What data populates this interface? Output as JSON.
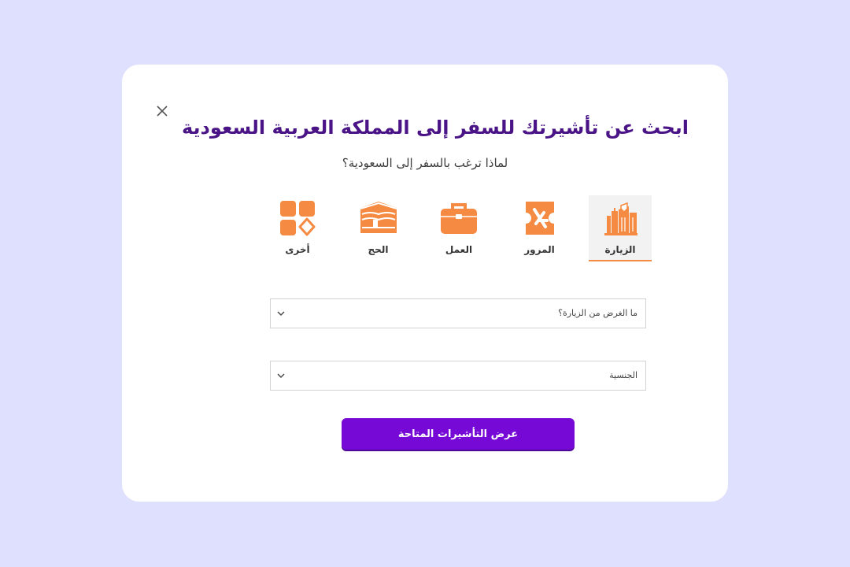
{
  "colors": {
    "page_bg": "#dfe0fd",
    "title": "#4a1486",
    "icon_accent": "#f58a42",
    "button": "#7609d6"
  },
  "modal": {
    "title": "ابحث عن تأشيرتك للسفر إلى المملكة العربية السعودية",
    "subtitle": "لماذا ترغب بالسفر إلى السعودية؟",
    "close_icon": "close-icon"
  },
  "categories": [
    {
      "label": "الزيارة",
      "icon": "buildings-icon",
      "selected": true
    },
    {
      "label": "المرور",
      "icon": "plane-ticket-icon",
      "selected": false
    },
    {
      "label": "العمل",
      "icon": "briefcase-icon",
      "selected": false
    },
    {
      "label": "الحج",
      "icon": "kaaba-icon",
      "selected": false
    },
    {
      "label": "أخرى",
      "icon": "grid-icon",
      "selected": false
    }
  ],
  "form": {
    "purpose_placeholder": "ما الغرض من الزيارة؟",
    "nationality_placeholder": "الجنسية",
    "submit_label": "عرض التأشيرات المتاحة"
  }
}
